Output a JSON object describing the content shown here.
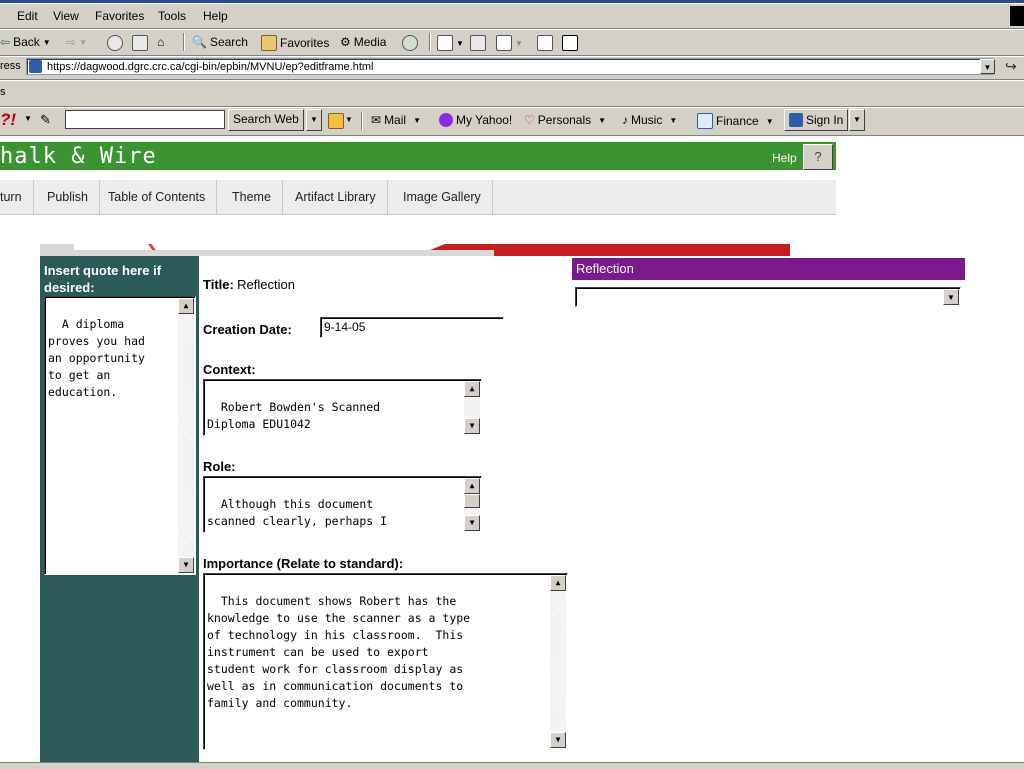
{
  "menubar": {
    "items": [
      "Edit",
      "View",
      "Favorites",
      "Tools",
      "Help"
    ]
  },
  "toolbar": {
    "back": "Back",
    "search": "Search",
    "favorites": "Favorites",
    "media": "Media"
  },
  "address": {
    "label": "ress",
    "url": "https://dagwood.dgrc.crc.ca/cgi-bin/epbin/MVNU/ep?editframe.html"
  },
  "links": {
    "label": "s"
  },
  "yahoo": {
    "search_button": "Search Web",
    "mail": "Mail",
    "my_yahoo": "My Yahoo!",
    "personals": "Personals",
    "music": "Music",
    "finance": "Finance",
    "sign_in": "Sign In"
  },
  "app": {
    "title": "halk & Wire",
    "help_label": "Help",
    "help_button": "?"
  },
  "nav": {
    "items": [
      "turn",
      "Publish",
      "Table of Contents",
      "Theme",
      "Artifact Library",
      "Image Gallery"
    ]
  },
  "quote": {
    "label": "Insert quote here if desired:",
    "value": "A diploma\nproves you had\nan opportunity\nto get an\neducation."
  },
  "form": {
    "title_label": "Title:",
    "title_value": "Reflection",
    "creation_label": "Creation Date:",
    "creation_value": "9-14-05",
    "context_label": "Context:",
    "context_value": "Robert Bowden's Scanned\nDiploma EDU1042",
    "role_label": "Role:",
    "role_value": "Although this document\nscanned clearly, perhaps I\nwould suggest centering the",
    "importance_label": "Importance (Relate to standard):",
    "importance_value": "This document shows Robert has the\nknowledge to use the scanner as a type\nof technology in his classroom.  This\ninstrument can be used to export\nstudent work for classroom display as\nwell as in communication documents to\nfamily and community."
  },
  "reflection": {
    "header": "Reflection",
    "select_value": ""
  },
  "colors": {
    "header_green": "#3b9431",
    "teal": "#2b5a59",
    "purple": "#7a1a8c"
  }
}
